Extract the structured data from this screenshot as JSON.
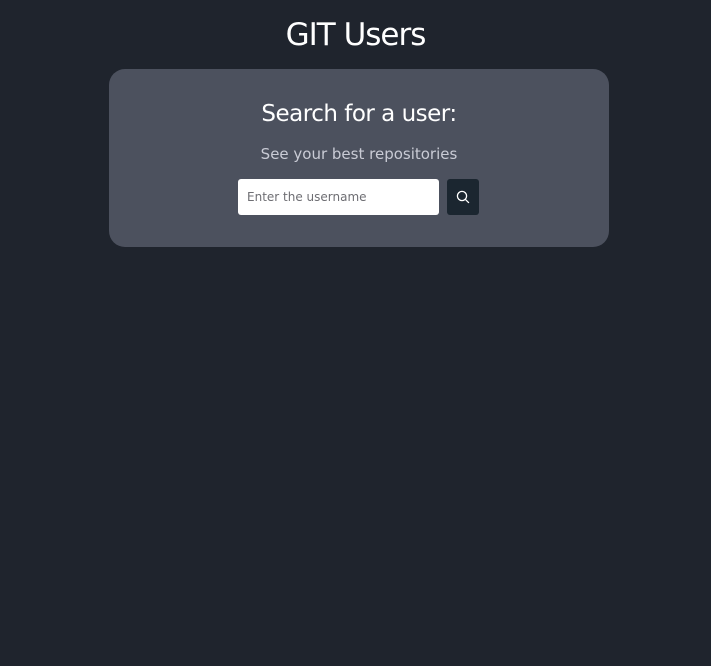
{
  "header": {
    "title": "GIT Users"
  },
  "search_card": {
    "heading": "Search for a user:",
    "subheading": "See your best repositories",
    "input": {
      "value": "",
      "placeholder": "Enter the username"
    },
    "button": {
      "icon": "search-icon"
    }
  },
  "colors": {
    "background": "#1f242d",
    "card": "#4c515e",
    "button": "#1b2630",
    "text": "#ffffff",
    "subtext": "#c9cbd5"
  }
}
